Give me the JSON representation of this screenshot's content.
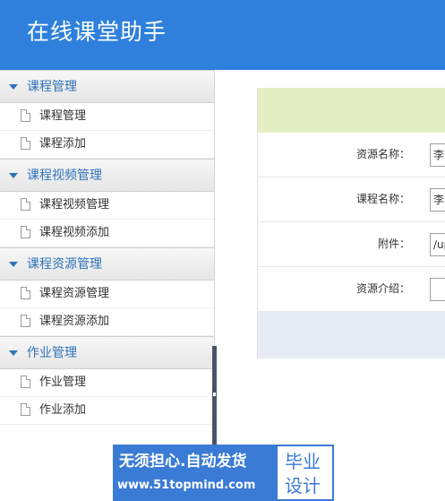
{
  "header": {
    "title": "在线课堂助手"
  },
  "sidebar": {
    "groups": [
      {
        "label": "课程管理",
        "items": [
          {
            "label": "课程管理"
          },
          {
            "label": "课程添加"
          }
        ]
      },
      {
        "label": "课程视频管理",
        "items": [
          {
            "label": "课程视频管理"
          },
          {
            "label": "课程视频添加"
          }
        ]
      },
      {
        "label": "课程资源管理",
        "items": [
          {
            "label": "课程资源管理"
          },
          {
            "label": "课程资源添加"
          }
        ]
      },
      {
        "label": "作业管理",
        "items": [
          {
            "label": "作业管理"
          },
          {
            "label": "作业添加"
          }
        ]
      }
    ]
  },
  "form": {
    "fields": [
      {
        "label": "资源名称：",
        "value": "李"
      },
      {
        "label": "课程名称：",
        "value": "李"
      },
      {
        "label": "附件：",
        "value": "/up"
      },
      {
        "label": "资源介绍：",
        "value": ""
      }
    ]
  },
  "watermark": {
    "line1": "无须担心.自动发货",
    "line2": "www.51topmind.com",
    "badge_top": "毕业",
    "badge_bottom": "设计"
  },
  "colors": {
    "header": "#2f80dc",
    "accent": "#2f73b8",
    "form_top": "#e3eec3",
    "form_bottom": "#e6ebf4"
  }
}
